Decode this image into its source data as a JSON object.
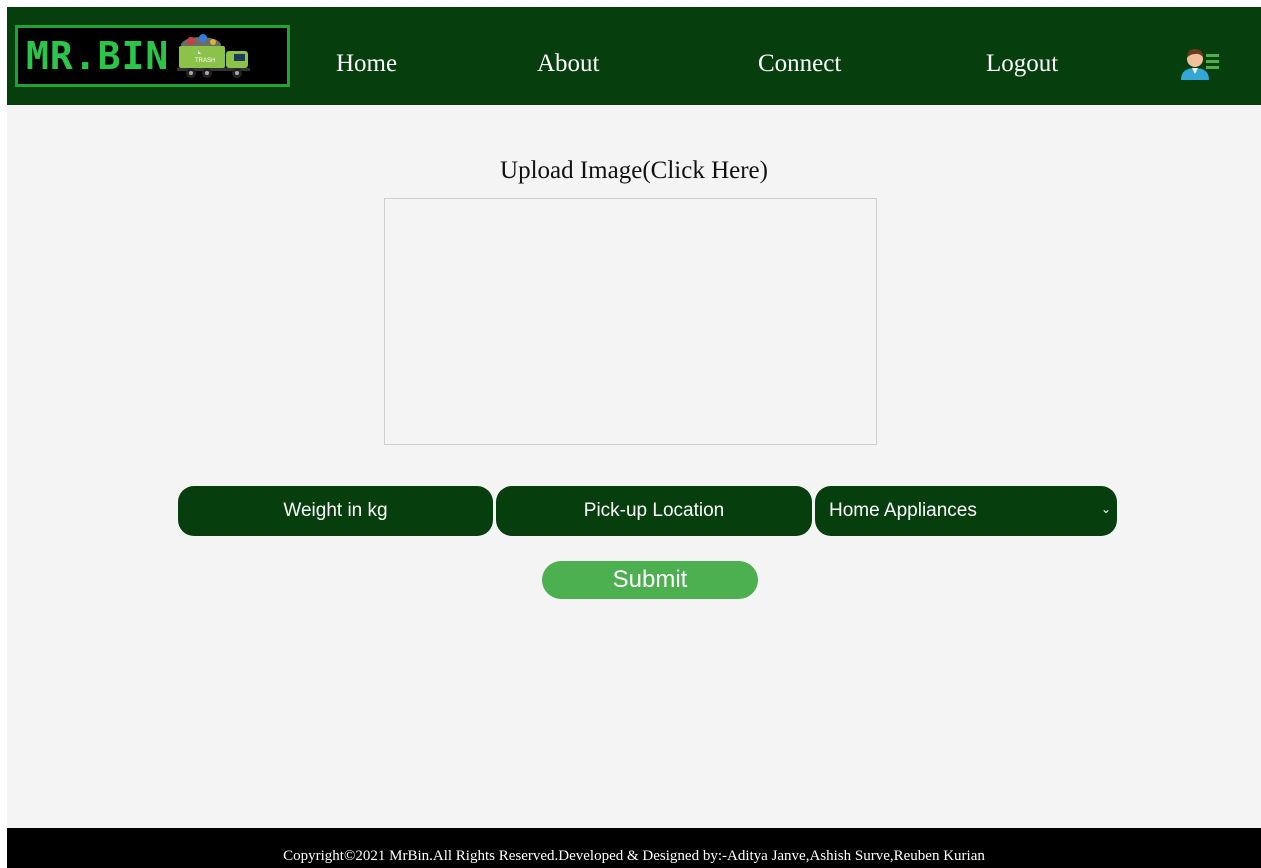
{
  "brand": {
    "logo_text": "MR.BIN",
    "logo_color": "#2cc54a",
    "truck_label": "TRASH"
  },
  "nav": {
    "home": "Home",
    "about": "About",
    "connect": "Connect",
    "logout": "Logout",
    "user_icon": "user-menu-icon"
  },
  "upload": {
    "label": "Upload Image(Click Here)"
  },
  "form": {
    "weight_placeholder": "Weight in kg",
    "location_placeholder": "Pick-up Location",
    "category_selected": "Home Appliances",
    "submit_label": "Submit"
  },
  "footer": {
    "text": "Copyright©2021 MrBin.All Rights Reserved.Developed & Designed by:-Aditya Janve,Ashish Surve,Reuben Kurian"
  },
  "colors": {
    "nav_bg": "#063f0d",
    "accent": "#4caf50",
    "footer_bg": "#000000"
  }
}
